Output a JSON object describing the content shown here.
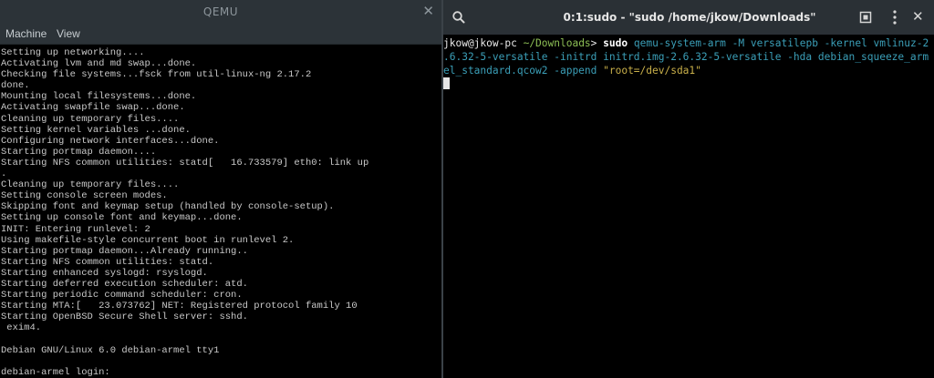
{
  "qemu": {
    "title": "QEMU",
    "menu": [
      "Machine",
      "View"
    ],
    "console_lines": [
      "Setting up networking....",
      "Activating lvm and md swap...done.",
      "Checking file systems...fsck from util-linux-ng 2.17.2",
      "done.",
      "Mounting local filesystems...done.",
      "Activating swapfile swap...done.",
      "Cleaning up temporary files....",
      "Setting kernel variables ...done.",
      "Configuring network interfaces...done.",
      "Starting portmap daemon....",
      "Starting NFS common utilities: statd[   16.733579] eth0: link up",
      ".",
      "Cleaning up temporary files....",
      "Setting console screen modes.",
      "Skipping font and keymap setup (handled by console-setup).",
      "Setting up console font and keymap...done.",
      "INIT: Entering runlevel: 2",
      "Using makefile-style concurrent boot in runlevel 2.",
      "Starting portmap daemon...Already running..",
      "Starting NFS common utilities: statd.",
      "Starting enhanced syslogd: rsyslogd.",
      "Starting deferred execution scheduler: atd.",
      "Starting periodic command scheduler: cron.",
      "Starting MTA:[   23.073762] NET: Registered protocol family 10",
      "Starting OpenBSD Secure Shell server: sshd.",
      " exim4.",
      "",
      "Debian GNU/Linux 6.0 debian-armel tty1",
      "",
      "debian-armel login: "
    ]
  },
  "terminal": {
    "title": "0:1:sudo - \"sudo /home/jkow/Downloads\"",
    "prompt_user": "jkow@jkow-pc",
    "prompt_path": "~/Downloads",
    "prompt_symbol": ">",
    "command": "sudo",
    "line1_args": "qemu-system-arm -M versatilepb -kernel vmlinuz-2",
    "line2": ".6.32-5-versatile -initrd initrd.img-2.6.32-5-versatile -hda debian_squeeze_arm",
    "line3_args": "el_standard.qcow2 -append ",
    "line3_string": "\"root=/dev/sda1\""
  },
  "icons": {
    "search": "search-icon",
    "new_tab": "new-tab-icon",
    "menu": "kebab-menu-icon",
    "close": "close-icon"
  },
  "colors": {
    "prompt_green": "#8dbf55",
    "argument_cyan": "#3b9fb8",
    "string_yellow": "#c9b04a",
    "titlebar": "#2c3338"
  }
}
